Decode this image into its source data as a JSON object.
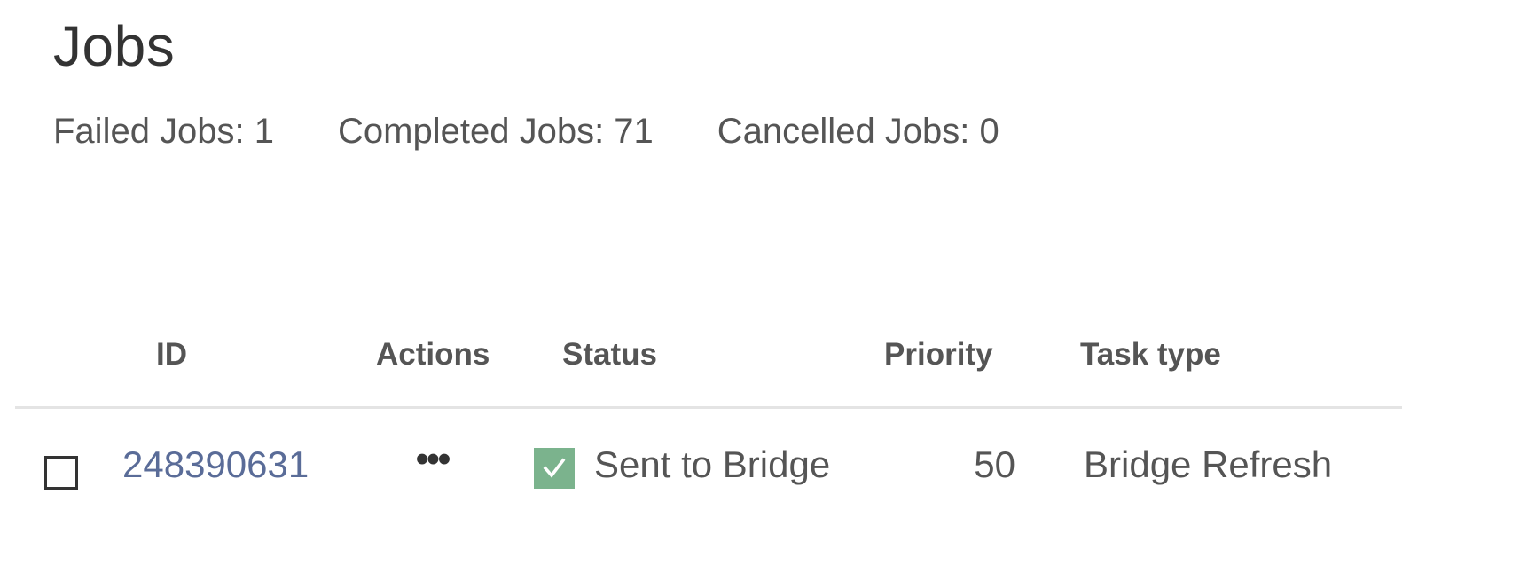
{
  "page": {
    "title": "Jobs"
  },
  "summary": {
    "failed": "Failed Jobs: 1",
    "completed": "Completed Jobs: 71",
    "cancelled": "Cancelled Jobs: 0"
  },
  "table": {
    "columns": {
      "id": "ID",
      "actions": "Actions",
      "status": "Status",
      "priority": "Priority",
      "task_type": "Task type"
    },
    "rows": [
      {
        "id": "248390631",
        "actions_icon": "more-horizontal-icon",
        "actions_glyph": "•••",
        "status": "Sent to Bridge",
        "status_icon": "check-icon",
        "status_color": "#7bb38d",
        "priority": "50",
        "task_type": "Bridge Refresh",
        "selected": false
      }
    ]
  },
  "colors": {
    "link": "#5a6c98",
    "text": "#555555",
    "divider": "#e4e4e4"
  }
}
